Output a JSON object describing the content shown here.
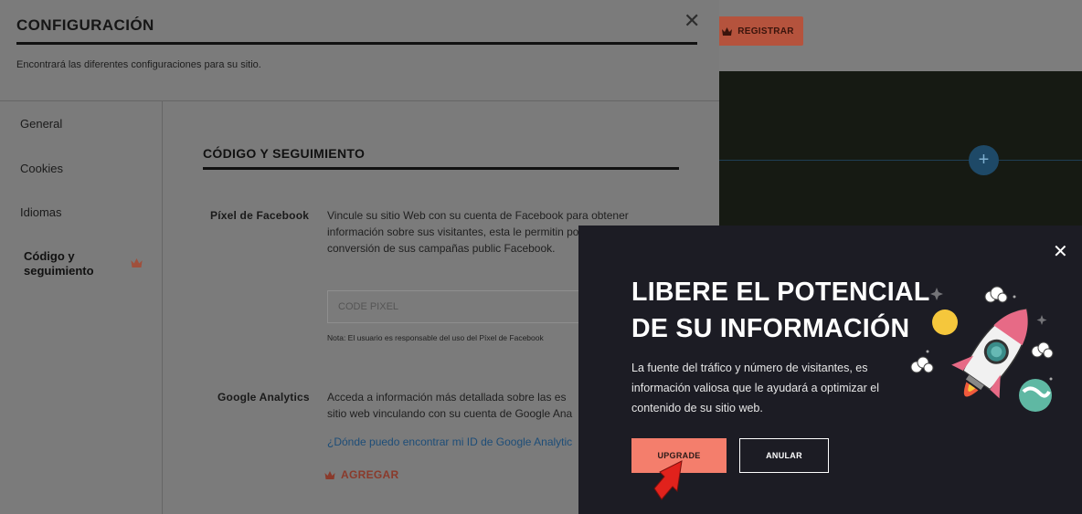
{
  "background": {
    "register_label": "REGISTRAR",
    "plus_label": "+"
  },
  "settings": {
    "title": "CONFIGURACIÓN",
    "close_label": "✕",
    "description": "Encontrará las diferentes configuraciones para su sitio.",
    "sidebar": [
      {
        "label": "General"
      },
      {
        "label": "Cookies"
      },
      {
        "label": "Idiomas"
      },
      {
        "label": "Código y seguimiento",
        "premium": true
      }
    ],
    "section_title": "CÓDIGO Y SEGUIMIENTO",
    "facebook": {
      "label": "Píxel de Facebook",
      "text": "Vincule su sitio Web con su cuenta de Facebook para obtener información sobre sus visitantes, esta le permitin porcentaje de conversión de sus campañas public Facebook.",
      "placeholder": "CODE PIXEL",
      "note": "Nota: El usuario es responsable del uso del Píxel de Facebook"
    },
    "google": {
      "label": "Google Analytics",
      "text": "Acceda a información más detallada sobre las es sitio web vinculando con su cuenta de Google Ana",
      "help_link": "¿Dónde puedo encontrar mi ID de Google Analytic",
      "add_label": "AGREGAR"
    }
  },
  "modal": {
    "close_label": "✕",
    "title": "LIBERE EL POTENCIAL DE SU INFORMACIÓN",
    "text": "La fuente del tráfico y número de visitantes, es información valiosa que le ayudará a optimizar el contenido de su sitio web.",
    "upgrade_label": "UPGRADE",
    "cancel_label": "ANULAR"
  },
  "colors": {
    "accent": "#f47e6c",
    "crown": "#b5533d",
    "modal_bg": "#1c1c24"
  }
}
